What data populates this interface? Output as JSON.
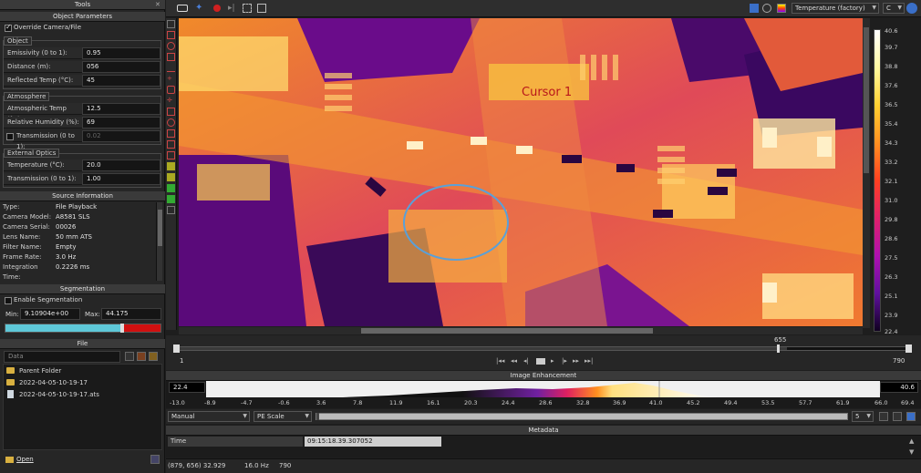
{
  "tools_panel": {
    "title": "Tools"
  },
  "object_params": {
    "title": "Object Parameters",
    "override_label": "Override Camera/File",
    "override_checked": true,
    "object_group": "Object",
    "emissivity_label": "Emissivity (0 to 1):",
    "emissivity": "0.95",
    "distance_label": "Distance (m):",
    "distance": "056",
    "reflected_label": "Reflected Temp (°C):",
    "reflected": "45",
    "atmosphere_group": "Atmosphere",
    "atm_temp_label": "Atmospheric Temp (°C):",
    "atm_temp": "12.5",
    "humidity_label": "Relative Humidity (%):",
    "humidity": "69",
    "transmission_label": "Transmission (0 to 1):",
    "transmission": "0.02",
    "ext_optics_group": "External Optics",
    "ext_temp_label": "Temperature (°C):",
    "ext_temp": "20.0",
    "ext_trans_label": "Transmission (0 to 1):",
    "ext_trans": "1.00"
  },
  "source_info": {
    "title": "Source Information",
    "rows": [
      {
        "k": "Type:",
        "v": "File Playback"
      },
      {
        "k": "Camera Model:",
        "v": "A8581 SLS"
      },
      {
        "k": "Camera Serial:",
        "v": "00026"
      },
      {
        "k": "Lens Name:",
        "v": "50 mm ATS"
      },
      {
        "k": "Filter Name:",
        "v": "Empty"
      },
      {
        "k": "Frame Rate:",
        "v": "3.0 Hz"
      },
      {
        "k": "Integration Time:",
        "v": "0.2226 ms"
      }
    ]
  },
  "segmentation": {
    "title": "Segmentation",
    "enable_label": "Enable Segmentation",
    "min_label": "Min:",
    "min": "9.10904e+00",
    "max_label": "Max:",
    "max": "44.175"
  },
  "file_panel": {
    "title": "File",
    "path_placeholder": "Data",
    "items": [
      {
        "label": "Parent Folder"
      },
      {
        "label": "2022-04-05-10-19-17"
      },
      {
        "label": "2022-04-05-10-19-17.ats"
      }
    ],
    "open_label": "Open"
  },
  "toolbar": {
    "palette_label": "Temperature (factory)",
    "unit_label": "C"
  },
  "viewer": {
    "cursor_label": "Cursor 1",
    "scale_ticks": [
      "40.6",
      "39.7",
      "38.8",
      "37.6",
      "36.5",
      "35.4",
      "34.3",
      "33.2",
      "32.1",
      "31.0",
      "29.8",
      "28.6",
      "27.5",
      "26.3",
      "25.1",
      "23.9",
      "22.4"
    ]
  },
  "timeline": {
    "start": "1",
    "end": "790",
    "marker": "655"
  },
  "image_enhancement": {
    "title": "Image Enhancement",
    "min": "22.4",
    "max": "40.6",
    "ticks": [
      "-13.0",
      "-8.9",
      "-4.7",
      "-0.6",
      "3.6",
      "7.8",
      "11.9",
      "16.1",
      "20.3",
      "24.4",
      "28.6",
      "32.8",
      "36.9",
      "41.0",
      "45.2",
      "49.4",
      "53.5",
      "57.7",
      "61.9",
      "66.0",
      "69.4"
    ],
    "mode": "Manual",
    "scale_mode": "PE Scale",
    "step": "5"
  },
  "metadata": {
    "title": "Metadata",
    "key": "Time",
    "value": "09:15:18.39.307052"
  },
  "status": {
    "coords": "(879, 656) 32.929",
    "rate": "16.0 Hz",
    "frames": "790"
  },
  "colors": {
    "accent_cyan": "#5ec8d8",
    "accent_red": "#d01010",
    "cursor_ring": "#5aa0d8"
  }
}
